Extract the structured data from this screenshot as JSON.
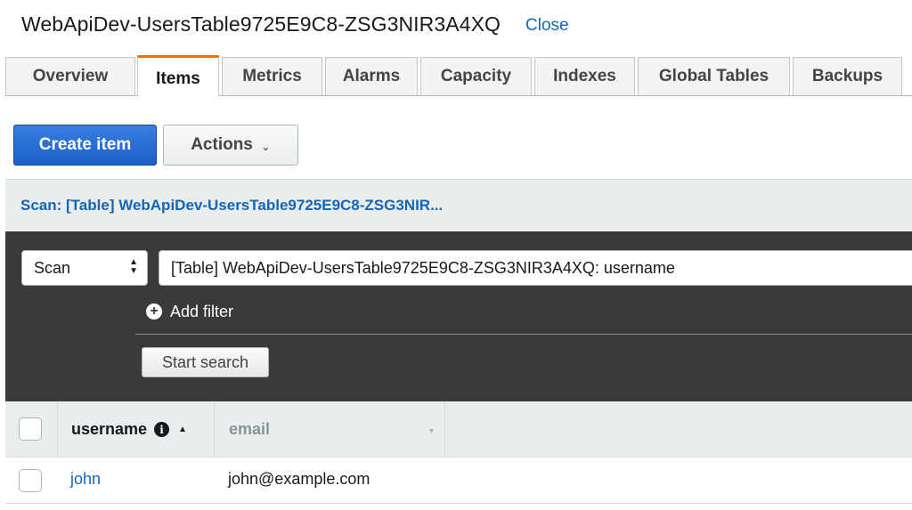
{
  "header": {
    "table_title": "WebApiDev-UsersTable9725E9C8-ZSG3NIR3A4XQ",
    "close_label": "Close"
  },
  "tabs": [
    {
      "label": "Overview",
      "active": false
    },
    {
      "label": "Items",
      "active": true
    },
    {
      "label": "Metrics",
      "active": false
    },
    {
      "label": "Alarms",
      "active": false
    },
    {
      "label": "Capacity",
      "active": false
    },
    {
      "label": "Indexes",
      "active": false
    },
    {
      "label": "Global Tables",
      "active": false
    },
    {
      "label": "Backups",
      "active": false
    }
  ],
  "toolbar": {
    "create_label": "Create item",
    "actions_label": "Actions"
  },
  "scan_bar": {
    "text": "Scan: [Table] WebApiDev-UsersTable9725E9C8-ZSG3NIR..."
  },
  "search": {
    "mode": "Scan",
    "index": "[Table] WebApiDev-UsersTable9725E9C8-ZSG3NIR3A4XQ: username",
    "add_filter_label": "Add filter",
    "start_label": "Start search"
  },
  "table": {
    "columns": [
      "username",
      "email"
    ],
    "rows": [
      {
        "username": "john",
        "email": "john@example.com"
      }
    ]
  },
  "icons": {
    "caret": "chevron-down-icon",
    "plus": "plus-circle-icon",
    "info": "info-icon",
    "sort_asc": "sort-up-icon",
    "sort_desc": "sort-down-icon"
  },
  "colors": {
    "accent_tab": "#ec7211",
    "primary_button": "#1c5fc7",
    "link": "#1166bb",
    "panel_dark": "#3a3a3a"
  }
}
